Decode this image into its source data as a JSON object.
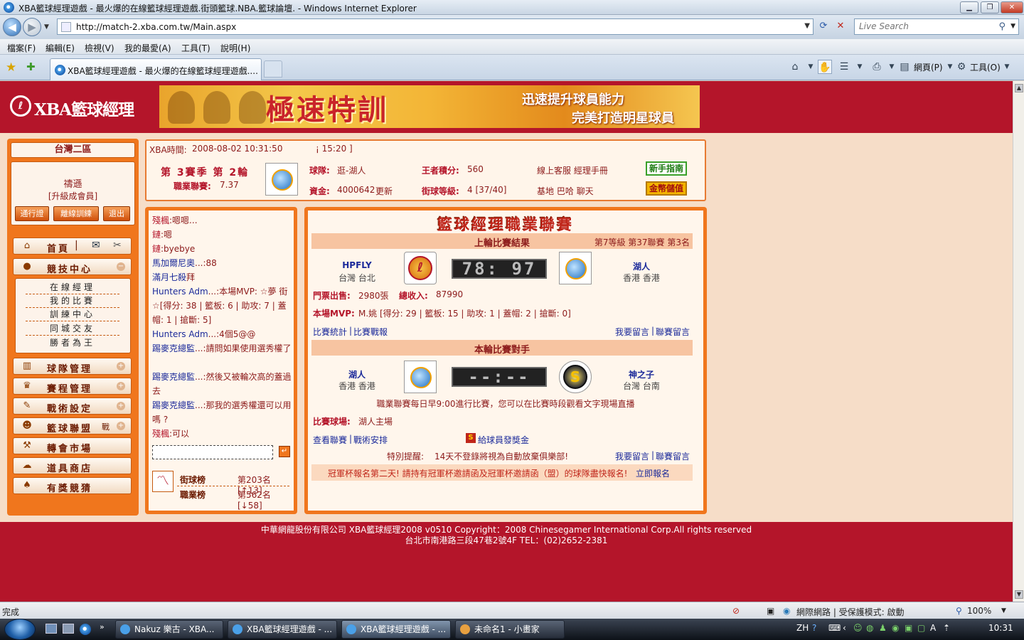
{
  "window": {
    "title": "XBA籃球經理遊戲 - 最火爆的在線籃球經理遊戲.街頭籃球.NBA.籃球論壇. - Windows Internet Explorer"
  },
  "address": {
    "url": "http://match-2.xba.com.tw/Main.aspx",
    "search_placeholder": "Live Search"
  },
  "menu": [
    "檔案(F)",
    "編輯(E)",
    "檢視(V)",
    "我的最愛(A)",
    "工具(T)",
    "說明(H)"
  ],
  "tab": {
    "label": "XBA籃球經理遊戲 - 最火爆的在線籃球經理遊戲...."
  },
  "toolbar": {
    "page_label": "網頁(P)",
    "tools_label": "工具(O)"
  },
  "site": {
    "logo_text": "XBA籃球經理",
    "banner": {
      "title": "極速特訓",
      "line1": "迅速提升球員能力",
      "line2": "完美打造明星球員"
    }
  },
  "sidebar": {
    "server": "台灣二區",
    "username": "禱遜",
    "member_link": "[升級成會員]",
    "buttons": [
      "通行證",
      "離線訓練",
      "退出"
    ],
    "nav": [
      {
        "label": "首頁",
        "icon": "home-icon"
      },
      {
        "label": "競技中心",
        "icon": "basketball-icon"
      },
      {
        "label": "球隊管理",
        "icon": "team-icon"
      },
      {
        "label": "賽程管理",
        "icon": "trophy-icon"
      },
      {
        "label": "戰術設定",
        "icon": "tactics-icon"
      },
      {
        "label": "籃球聯盟",
        "icon": "league-icon",
        "badge": "戰"
      },
      {
        "label": "轉會市場",
        "icon": "hammer-icon"
      },
      {
        "label": "道具商店",
        "icon": "shop-icon"
      },
      {
        "label": "有獎競猜",
        "icon": "spade-icon"
      }
    ],
    "sub": [
      "在線經理",
      "我的比賽",
      "訓練中心",
      "同城交友",
      "勝者為王"
    ]
  },
  "info": {
    "time_label": "XBA時間:",
    "time_value": "2008-08-02 10:31:50",
    "countdown": "¡ 15:20 ]",
    "season": "第 3賽季 第 2輪",
    "league_label": "職業聯賽:",
    "league_value": "7.37",
    "team_label": "球隊:",
    "team_value": "逛-湖人",
    "king_label": "王者積分:",
    "king_value": "560",
    "links1": "線上客服  經理手冊",
    "funds_label": "資金:",
    "funds_value": "4000642",
    "refresh": "更新",
    "street_label": "街球等級:",
    "street_value": "4 [37/40]",
    "links2": "基地  巴哈  聊天",
    "guide_btn": "新手指南",
    "gold_btn": "金幣儲值"
  },
  "chat": {
    "lines": [
      {
        "who": "殘楓",
        "msg": ":嗯嗯..."
      },
      {
        "who": "鏈",
        "msg": ":嗯"
      },
      {
        "who": "鏈",
        "msg": ":byebye"
      },
      {
        "who": "馬加爾尼奧",
        "msg": "...:88"
      },
      {
        "who": "滿月七殺",
        "msg": "拜"
      },
      {
        "who": "Hunters Adm",
        "msg": "...:本場MVP: ☆夢 街☆[得分: 38 | 籃板: 6 | 助攻: 7 | 蓋帽: 1 | 搶斷: 5]"
      },
      {
        "who": "Hunters Adm",
        "msg": "...:4個5@@"
      },
      {
        "who": "踢麥克總監",
        "msg": "...:請問如果使用選秀權了"
      },
      {
        "who": "踢麥克總監",
        "msg": "...:然後又被輪次高的蓋過去"
      },
      {
        "who": "踢麥克總監",
        "msg": "...:那我的選秀權還可以用嗎 ?"
      },
      {
        "who": "殘楓",
        "msg": ":可以"
      }
    ],
    "rank_street_label": "街球榜",
    "rank_street_value": "第203名[↑13]",
    "rank_pro_label": "職業榜",
    "rank_pro_value": "第562名[↓58]"
  },
  "league": {
    "title": "籃球經理職業聯賽",
    "last_result_title": "上輪比賽結果",
    "last_result_meta": "第7等級 第37聯賽 第3名",
    "home_team": "HPFLY",
    "home_loc": "台灣 台北",
    "score": "78: 97",
    "away_team": "湖人",
    "away_loc": "香港 香港",
    "tickets_label": "門票出售:",
    "tickets_value": "2980張",
    "revenue_label": "總收入:",
    "revenue_value": "87990",
    "mvp_label": "本場MVP:",
    "mvp_value": "M.姚 [得分: 29 | 籃板: 15 | 助攻: 1 | 蓋帽: 2 | 搶斷: 0]",
    "stats_link": "比賽統計",
    "report_link": "比賽戰報",
    "msg_link": "我要留言",
    "league_msg_link": "聯賽留言",
    "next_title": "本輪比賽對手",
    "next_home": "湖人",
    "next_home_loc": "香港 香港",
    "next_score": "--:--",
    "next_away": "神之子",
    "next_away_loc": "台灣 台南",
    "schedule_note": "職業聯賽每日早9:00進行比賽，您可以在比賽時段觀看文字現場直播",
    "venue_label": "比賽球場:",
    "venue_value": "湖人主場",
    "view_league": "查看聯賽",
    "tactics": "戰術安排",
    "bonus": "給球員發獎金",
    "reminder_label": "特別提醒:",
    "reminder_text": "14天不登錄將視為自動放棄俱樂部!",
    "cup_notice": "冠軍杯報名第二天! 請持有冠軍杯邀請函及冠軍杯邀請函（盟）的球隊盡快報名!",
    "cup_link": "立即報名"
  },
  "footer": {
    "line1": "中華網龍股份有限公司  XBA籃球經理2008 v0510     Copyright：2008 Chinesegamer International Corp.All rights reserved",
    "line2": "台北市南港路三段47巷2號4F TEL：(02)2652-2381"
  },
  "status": {
    "left": "完成",
    "zone": "網際網路 | 受保護模式: 啟動",
    "zoom": "100%"
  },
  "taskbar": {
    "tasks": [
      "Nakuz 樂古 - XBA...",
      "XBA籃球經理遊戲 - ...",
      "XBA籃球經理遊戲 - ...",
      "未命名1 - 小畫家"
    ],
    "lang": "ZH",
    "clock": "10:31"
  }
}
